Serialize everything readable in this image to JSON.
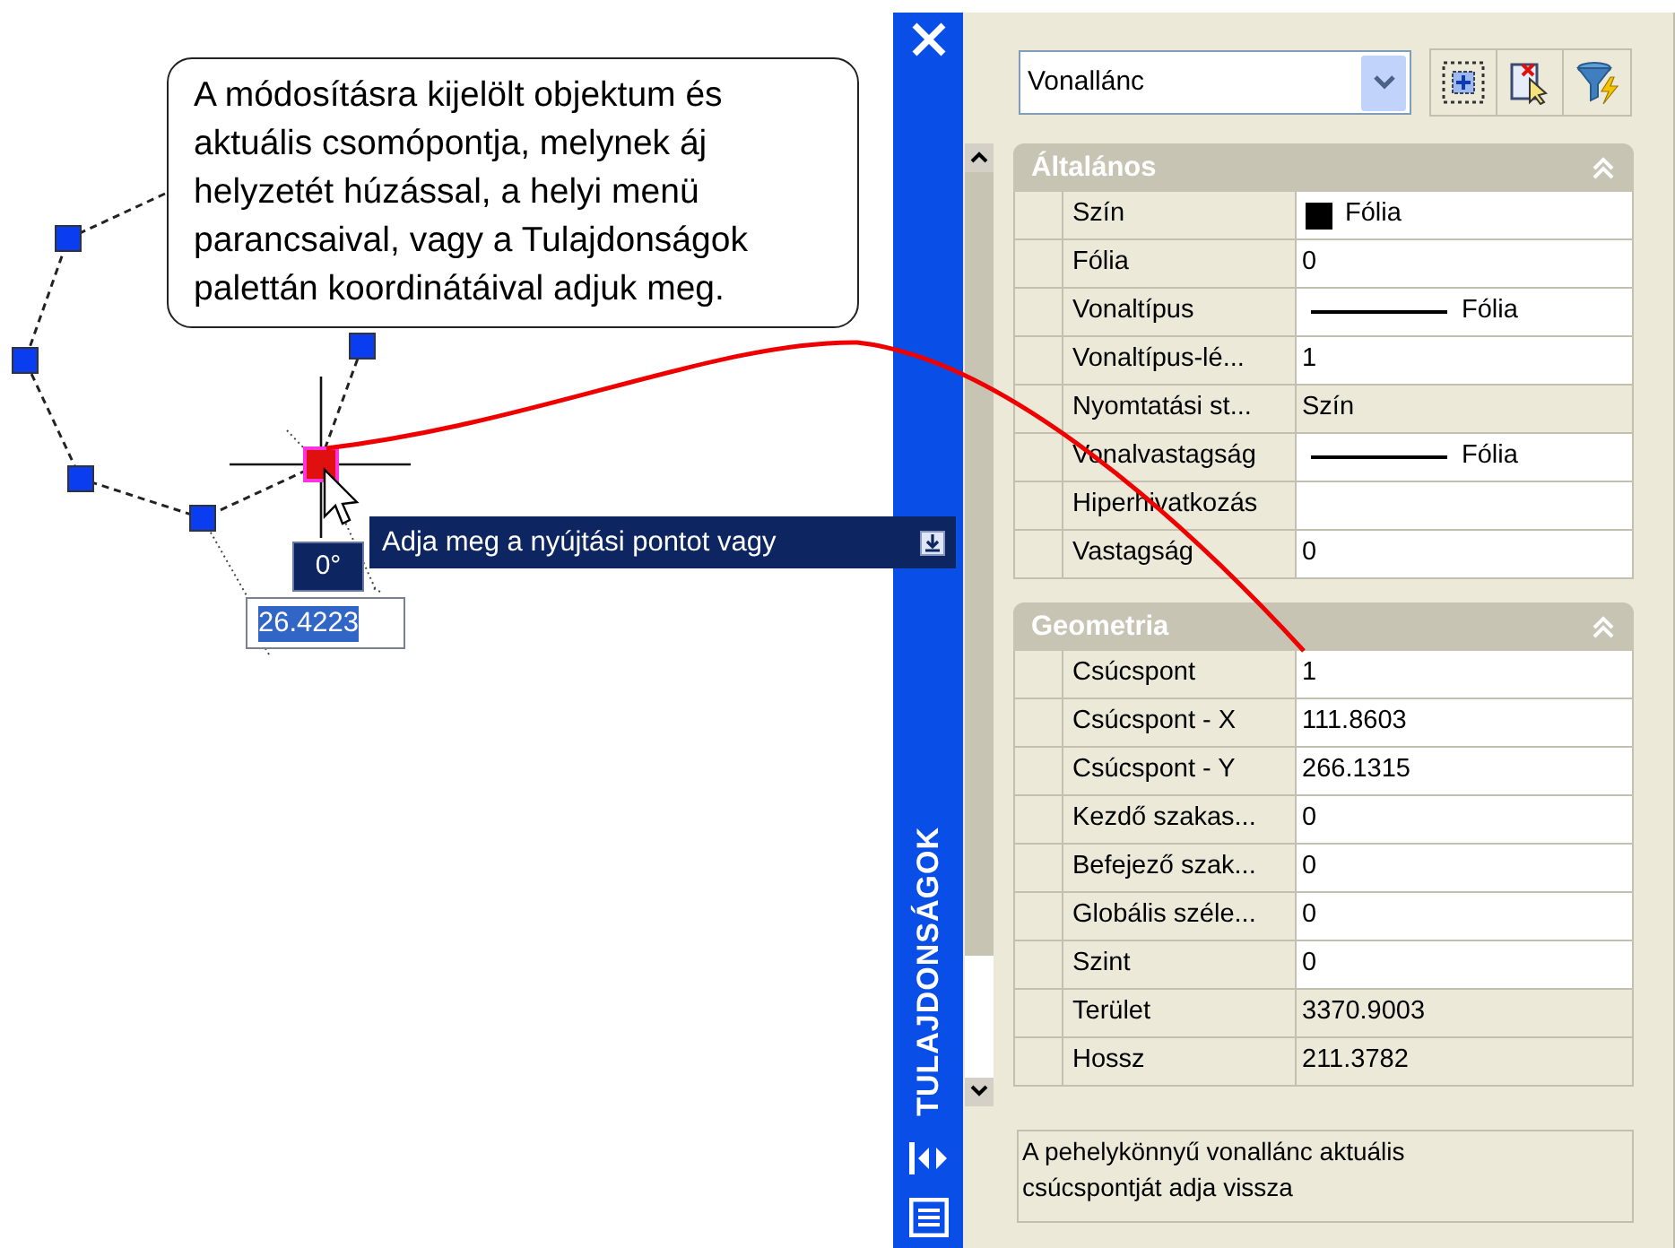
{
  "callout": {
    "text": "A módosításra kijelölt objektum és aktuális csomópontja, melynek áj helyzetét húzással, a helyi menü parancsaival, vagy a Tulajdonságok palettán koordinátáival adjuk meg."
  },
  "angle_tip": "0°",
  "prompt": "Adja meg a nyújtási pontot vagy",
  "distance_input": "26.4223",
  "palette": {
    "title": "TULAJDONSÁGOK",
    "object_type": "Vonallánc",
    "sections": [
      {
        "title": "Általános",
        "expanded": true,
        "rows": [
          {
            "label": "Szín",
            "value": "Fólia",
            "kind": "color",
            "readonly": false
          },
          {
            "label": "Fólia",
            "value": "0",
            "kind": "text",
            "readonly": false
          },
          {
            "label": "Vonaltípus",
            "value": "Fólia",
            "kind": "linetype",
            "readonly": false
          },
          {
            "label": "Vonaltípus-lé...",
            "value": "1",
            "kind": "text",
            "readonly": false
          },
          {
            "label": "Nyomtatási st...",
            "value": "Szín",
            "kind": "text",
            "readonly": true
          },
          {
            "label": "Vonalvastagság",
            "value": "Fólia",
            "kind": "linetype",
            "readonly": false
          },
          {
            "label": "Hiperhivatkozás",
            "kind": "text",
            "readonly": false
          },
          {
            "label": "Vastagság",
            "value": "0",
            "kind": "text",
            "readonly": false
          }
        ]
      },
      {
        "title": "Geometria",
        "expanded": true,
        "rows": [
          {
            "label": "Csúcspont",
            "value": "1",
            "kind": "text",
            "readonly": false
          },
          {
            "label": "Csúcspont - X",
            "value": "111.8603",
            "kind": "text",
            "readonly": false
          },
          {
            "label": "Csúcspont - Y",
            "value": "266.1315",
            "kind": "text",
            "readonly": false
          },
          {
            "label": "Kezdő szakas...",
            "value": "0",
            "kind": "text",
            "readonly": false
          },
          {
            "label": "Befejező szak...",
            "value": "0",
            "kind": "text",
            "readonly": false
          },
          {
            "label": "Globális széle...",
            "value": "0",
            "kind": "text",
            "readonly": false
          },
          {
            "label": "Szint",
            "value": "0",
            "kind": "text",
            "readonly": false
          },
          {
            "label": "Terület",
            "value": "3370.9003",
            "kind": "text",
            "readonly": true
          },
          {
            "label": "Hossz",
            "value": "211.3782",
            "kind": "text",
            "readonly": true
          }
        ]
      }
    ],
    "description": "A pehelykönnyű vonallánc aktuális csúcspontját adja vissza"
  }
}
